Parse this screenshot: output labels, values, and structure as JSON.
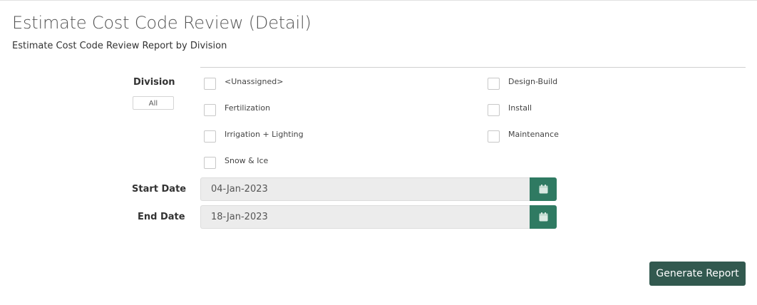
{
  "header": {
    "title": "Estimate Cost Code Review (Detail)",
    "subtitle": "Estimate Cost Code Review Report by Division"
  },
  "division": {
    "label": "Division",
    "all_button": "All",
    "options": [
      {
        "label": "<Unassigned>",
        "checked": false
      },
      {
        "label": "Design-Build",
        "checked": false
      },
      {
        "label": "Fertilization",
        "checked": false
      },
      {
        "label": "Install",
        "checked": false
      },
      {
        "label": "Irrigation + Lighting",
        "checked": false
      },
      {
        "label": "Maintenance",
        "checked": false
      },
      {
        "label": "Snow & Ice",
        "checked": false
      }
    ]
  },
  "start_date": {
    "label": "Start Date",
    "value": "04-Jan-2023",
    "icon": "calendar-icon"
  },
  "end_date": {
    "label": "End Date",
    "value": "18-Jan-2023",
    "icon": "calendar-icon"
  },
  "actions": {
    "generate_label": "Generate Report"
  },
  "colors": {
    "calendar_button": "#2f7a62",
    "generate_button": "#32594f",
    "input_background": "#ececec"
  }
}
